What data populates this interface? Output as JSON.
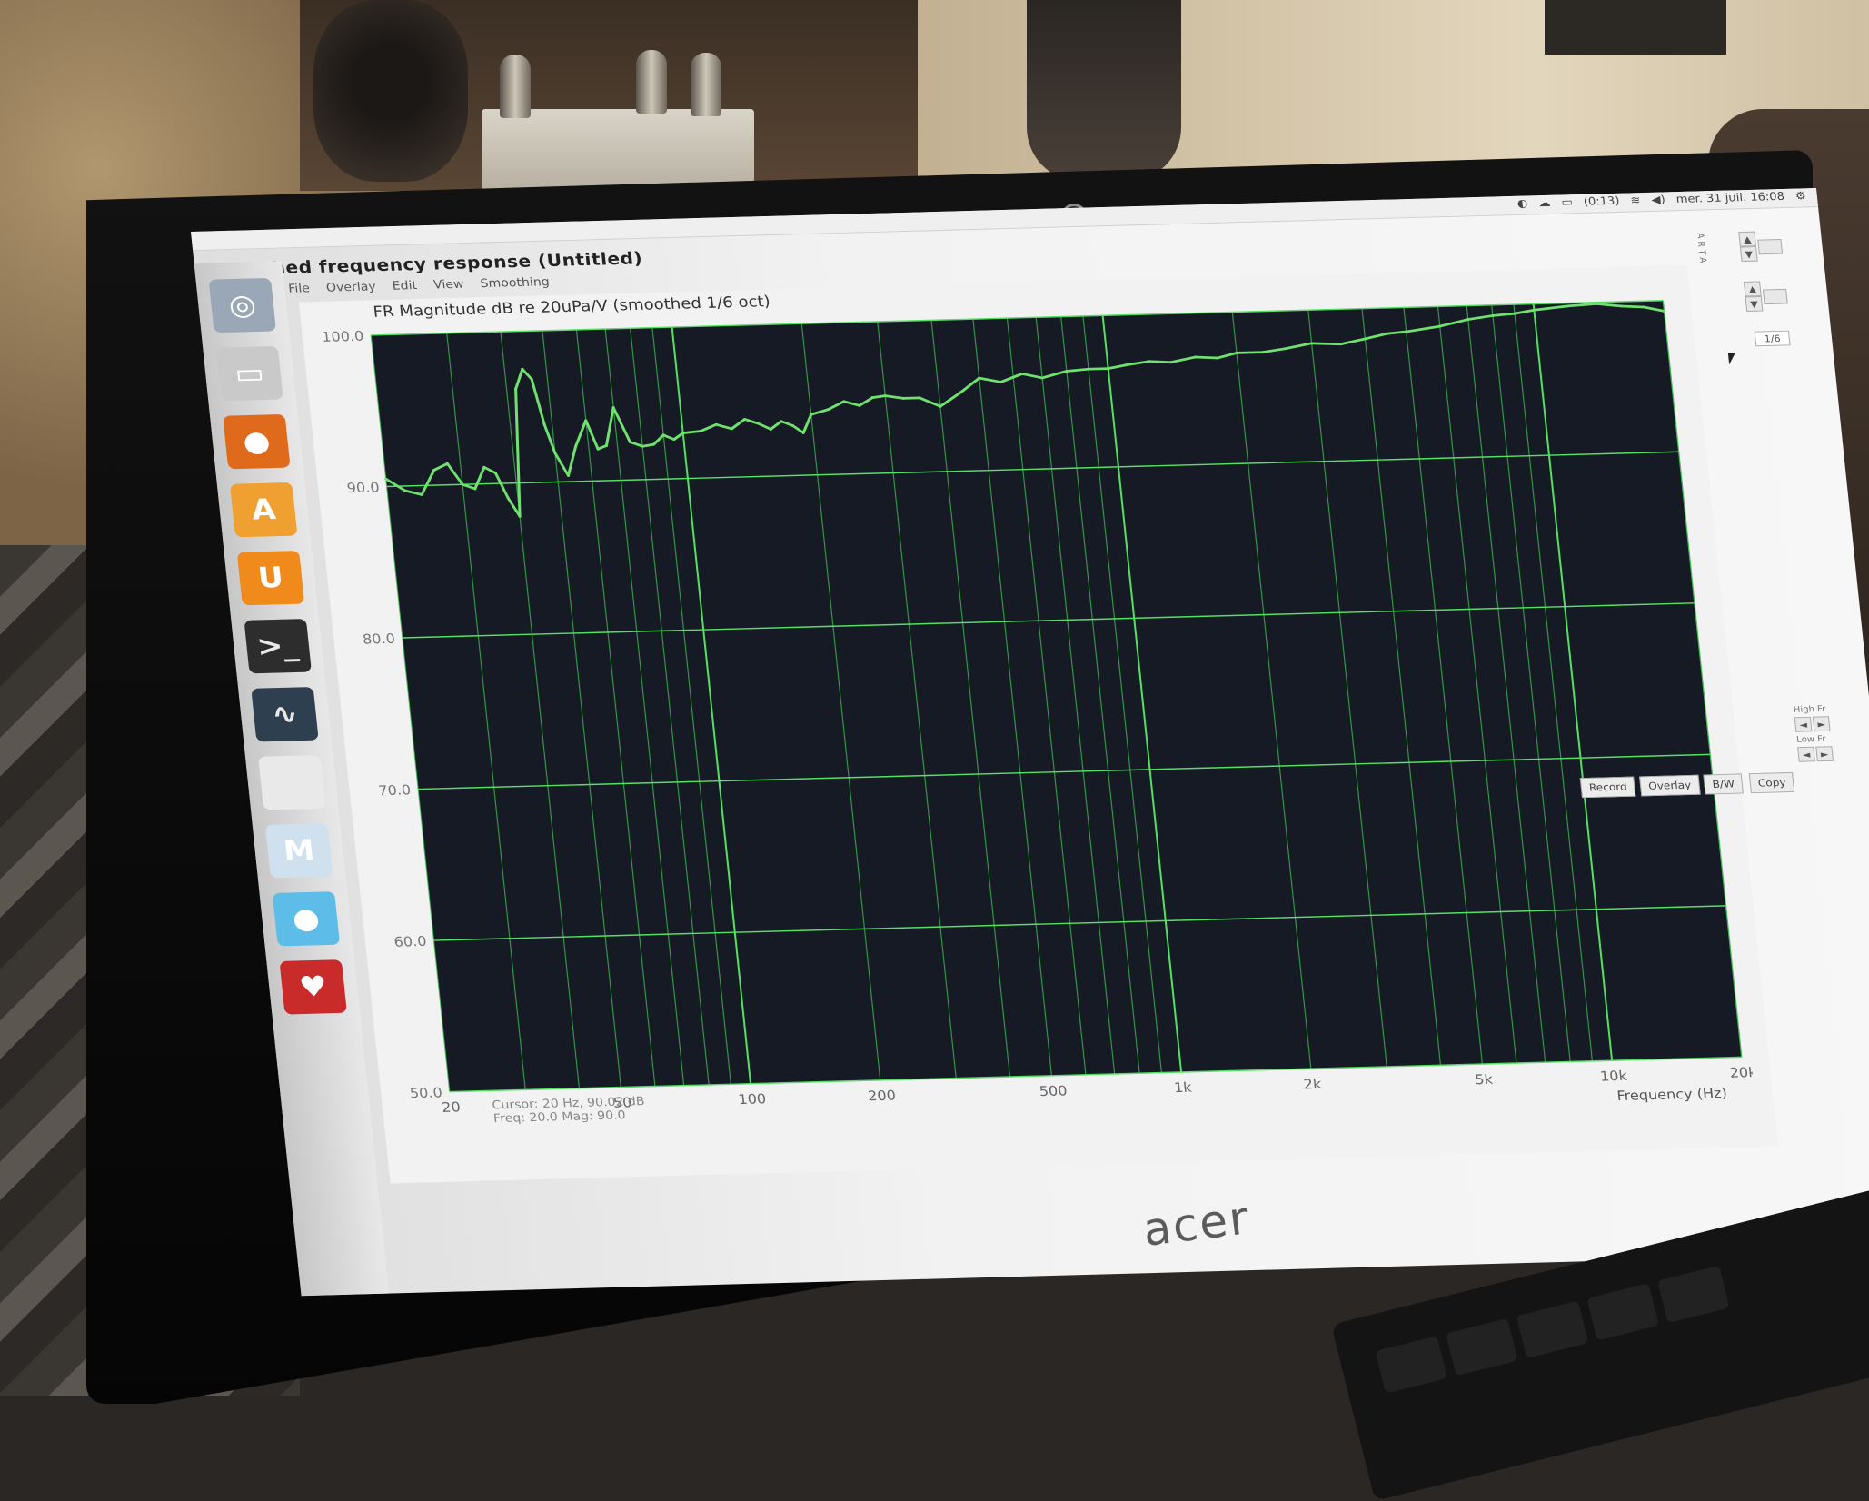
{
  "window": {
    "title": "Smoothed frequency response (Untitled)",
    "menu": [
      "File",
      "Overlay",
      "Edit",
      "View",
      "Smoothing"
    ]
  },
  "tray": {
    "battery": "(0:13)",
    "clock": "mer. 31 juil. 16:08"
  },
  "launcher": [
    {
      "name": "ubuntu-home-icon",
      "glyph": "◎",
      "color": "#9aa7b7"
    },
    {
      "name": "files-icon",
      "glyph": "▭",
      "color": "#c9c9c9"
    },
    {
      "name": "firefox-icon",
      "glyph": "●",
      "color": "#e06a1c"
    },
    {
      "name": "software-center-icon",
      "glyph": "A",
      "color": "#f0a030"
    },
    {
      "name": "ubuntu-one-icon",
      "glyph": "U",
      "color": "#f08a1a"
    },
    {
      "name": "terminal-icon",
      "glyph": ">_",
      "color": "#2d2d2d"
    },
    {
      "name": "system-monitor-icon",
      "glyph": "∿",
      "color": "#2e3f4f"
    },
    {
      "name": "blank-app-icon",
      "glyph": "",
      "color": "#e9e9e9"
    },
    {
      "name": "m-app-icon",
      "glyph": "M",
      "color": "#cfe0ee"
    },
    {
      "name": "blue-app-icon",
      "glyph": "●",
      "color": "#5dbde8"
    },
    {
      "name": "wine-icon",
      "glyph": "♥",
      "color": "#c92a2a"
    }
  ],
  "side_label": "A R T A",
  "controls": {
    "top_up": "▲",
    "top_down": "▼",
    "smoothing_value": "1/6",
    "high_fr_label": "High Fr",
    "low_fr_label": "Low Fr",
    "left_arrow": "◄",
    "right_arrow": "►"
  },
  "buttons": [
    "Record",
    "Overlay",
    "B/W",
    "Copy"
  ],
  "brand": "acer",
  "chart_data": {
    "type": "line",
    "title": "FR Magnitude dB re 20uPa/V (smoothed 1/6 oct)",
    "xlabel": "Frequency (Hz)",
    "ylabel": "",
    "xscale": "log",
    "xlim": [
      20,
      20000
    ],
    "ylim": [
      50,
      100
    ],
    "y_ticks": [
      "100.0",
      "90.0",
      "80.0",
      "70.0",
      "60.0",
      "50.0"
    ],
    "y_tick_values": [
      100,
      90,
      80,
      70,
      60,
      50
    ],
    "x_ticks": [
      "20",
      "50",
      "100",
      "200",
      "500",
      "1k",
      "2k",
      "5k",
      "10k",
      "20k"
    ],
    "x_tick_values": [
      20,
      50,
      100,
      200,
      500,
      1000,
      2000,
      5000,
      10000,
      20000
    ],
    "grid": true,
    "series": [
      {
        "color": "#6fe16f",
        "x": [
          20,
          22,
          24,
          26,
          28,
          30,
          32,
          34,
          36,
          38,
          40,
          42,
          44,
          46,
          48,
          50,
          53,
          56,
          60,
          63,
          66,
          70,
          75,
          80,
          85,
          90,
          95,
          100,
          110,
          120,
          130,
          140,
          150,
          160,
          170,
          180,
          190,
          200,
          220,
          240,
          260,
          280,
          300,
          330,
          360,
          400,
          450,
          500,
          560,
          630,
          700,
          800,
          900,
          1000,
          1100,
          1250,
          1400,
          1600,
          1800,
          2000,
          2300,
          2600,
          3000,
          3500,
          4000,
          4500,
          5000,
          6000,
          7000,
          8000,
          9000,
          10000,
          12000,
          14000,
          16000,
          18000,
          20000
        ],
        "y": [
          90.5,
          89.7,
          89.4,
          91.0,
          91.4,
          90.0,
          89.7,
          91.1,
          90.7,
          89.0,
          87.8,
          96.2,
          97.5,
          96.8,
          93.8,
          91.9,
          90.4,
          92.3,
          94.0,
          92.1,
          92.3,
          94.8,
          92.5,
          92.2,
          92.3,
          92.9,
          92.6,
          93.0,
          93.1,
          93.5,
          93.2,
          93.8,
          93.5,
          93.1,
          93.6,
          93.3,
          92.8,
          94.0,
          94.3,
          94.8,
          94.5,
          95.0,
          95.1,
          94.9,
          94.9,
          94.3,
          95.2,
          96.1,
          95.8,
          96.3,
          96.0,
          96.4,
          96.5,
          96.5,
          96.7,
          96.9,
          96.8,
          97.1,
          97.0,
          97.3,
          97.3,
          97.5,
          97.8,
          97.7,
          98.0,
          98.3,
          98.4,
          98.7,
          99.1,
          99.3,
          99.4,
          99.6,
          99.8,
          99.9,
          99.7,
          99.6,
          99.3
        ]
      }
    ]
  },
  "bottom_readout": {
    "cursor": "Cursor: 20 Hz, 90.02 dB",
    "line2": "Freq: 20.0  Mag: 90.0"
  }
}
